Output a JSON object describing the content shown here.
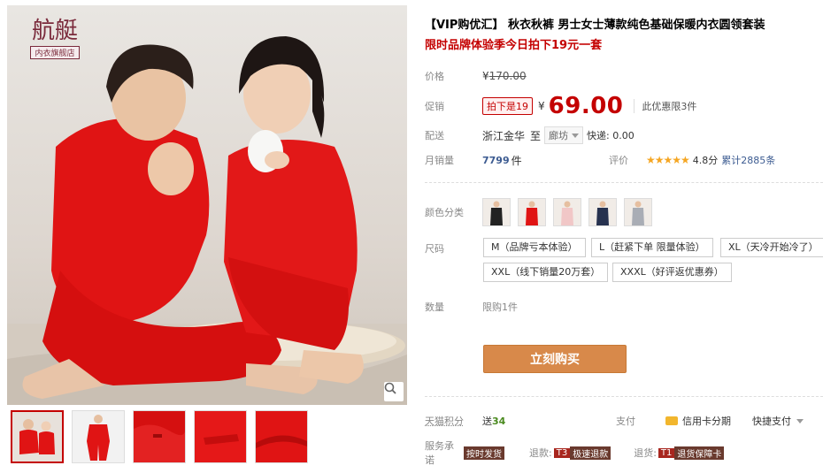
{
  "logo": {
    "chars": "航艇",
    "sub": "内衣旗舰店"
  },
  "product": {
    "title": "【VIP购优汇】 秋衣秋裤 男士女士薄款纯色基础保暖内衣圆领套装",
    "subtitle": "限时品牌体验季今日拍下19元一套"
  },
  "price": {
    "label": "价格",
    "yen": "¥",
    "original": "170.00"
  },
  "promo": {
    "label": "促销",
    "tag": "拍下是19",
    "yen": "¥",
    "price": "69.00",
    "limit": "此优惠限3件"
  },
  "shipping": {
    "label": "配送",
    "from": "浙江金华",
    "to_word": "至",
    "dest": "廊坊",
    "express": "快递: 0.00"
  },
  "sales": {
    "label": "月销量",
    "count": "7799",
    "unit": "件",
    "review_label": "评价",
    "stars": "★★★★★",
    "score": "4.8分",
    "total_reviews": "累计2885条"
  },
  "color": {
    "label": "颜色分类"
  },
  "size": {
    "label": "尺码",
    "options": [
      "M（品牌亏本体验）",
      "L（赶紧下单 限量体验）",
      "XL（天冷开始冷了）",
      "XXL（线下销量20万套）",
      "XXXL（好评返优惠券）"
    ]
  },
  "quantity": {
    "label": "数量",
    "limit": "限购1件"
  },
  "buy_button": "立刻购买",
  "points": {
    "label": "天猫积分",
    "send": "送",
    "value": "34",
    "pay_label": "支付",
    "card": "信用卡分期",
    "quick": "快捷支付"
  },
  "services": {
    "label": "服务承诺",
    "tag1": "按时发货",
    "refund_label": "退款:",
    "tag2a": "T3",
    "tag2b": "极速退款",
    "return_label": "退货:",
    "tag3a": "T1",
    "tag3b": "退货保障卡"
  },
  "colors": {
    "accent": "#c40000",
    "buy": "#d8894a",
    "garment": "#e01414",
    "star": "#f5a623"
  },
  "icons": {
    "zoom": "magnifier-icon",
    "caret": "chevron-down-icon",
    "card": "credit-card-icon"
  }
}
